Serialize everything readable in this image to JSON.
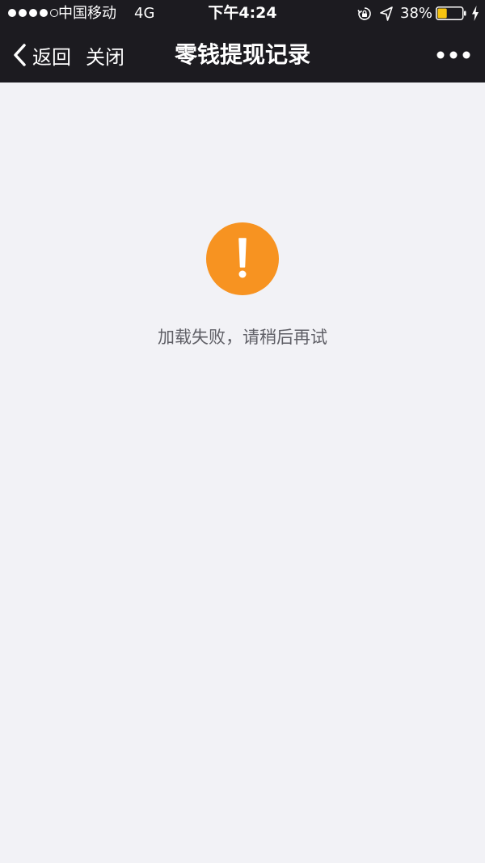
{
  "status_bar": {
    "carrier": "中国移动",
    "network": "4G",
    "time": "下午4:24",
    "battery_percent": "38%",
    "battery_level": 0.38,
    "battery_color": "#f7c410",
    "icons": [
      "signal-icon",
      "orientation-lock-icon",
      "location-icon",
      "battery-icon",
      "charging-icon"
    ]
  },
  "nav": {
    "back_label": "返回",
    "close_label": "关闭",
    "title": "零钱提现记录",
    "back_icon": "chevron-left-icon",
    "more_icon": "more-icon"
  },
  "content": {
    "error_icon": "exclamation-icon",
    "error_icon_color": "#f79321",
    "message": "加载失败，请稍后再试"
  },
  "colors": {
    "header_background": "#1c1b20",
    "page_background": "#f2f2f6"
  }
}
